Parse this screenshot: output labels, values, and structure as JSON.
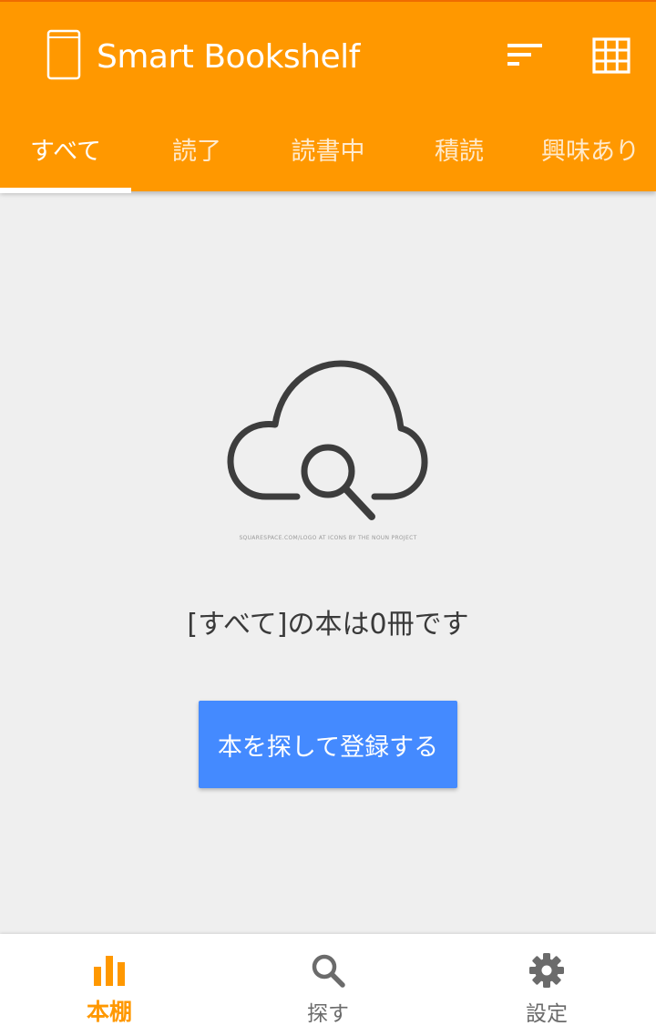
{
  "header": {
    "title": "Smart Bookshelf",
    "icons": {
      "logo": "book-icon",
      "sort": "sort-icon",
      "view": "grid-view-icon"
    }
  },
  "tabs": [
    {
      "label": "すべて",
      "active": true
    },
    {
      "label": "読了",
      "active": false
    },
    {
      "label": "読書中",
      "active": false
    },
    {
      "label": "積読",
      "active": false
    },
    {
      "label": "興味あり",
      "active": false
    }
  ],
  "empty_state": {
    "illustration": "cloud-search-icon",
    "credit": "SQUARESPACE.COM/LOGO AT ICONS BY THE NOUN PROJECT",
    "message": "[すべて]の本は0冊です",
    "button_label": "本を探して登録する"
  },
  "bottom_nav": [
    {
      "label": "本棚",
      "icon": "bookshelf-chart-icon",
      "active": true
    },
    {
      "label": "探す",
      "icon": "search-icon",
      "active": false
    },
    {
      "label": "設定",
      "icon": "gear-icon",
      "active": false
    }
  ],
  "colors": {
    "primary": "#ff9800",
    "button": "#448aff",
    "background": "#efefef",
    "inactive_nav": "#6b6b6b",
    "illustration": "#3d3d3d"
  }
}
